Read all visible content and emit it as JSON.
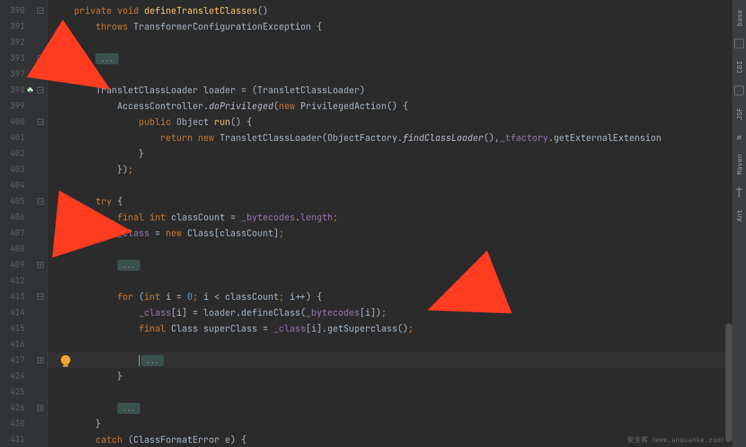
{
  "gutter": {
    "lines": [
      "390",
      "391",
      "392",
      "393",
      "397",
      "398",
      "399",
      "400",
      "401",
      "402",
      "403",
      "404",
      "405",
      "406",
      "407",
      "408",
      "409",
      "412",
      "413",
      "414",
      "415",
      "416",
      "417",
      "424",
      "425",
      "426",
      "430",
      "431"
    ]
  },
  "fold_chip": "...",
  "code": {
    "l390": {
      "indent": "    ",
      "tokens": [
        {
          "c": "k",
          "t": "private"
        },
        {
          "c": "t",
          "t": " "
        },
        {
          "c": "k",
          "t": "void"
        },
        {
          "c": "t",
          "t": " "
        },
        {
          "c": "m",
          "t": "defineTransletClasses"
        },
        {
          "c": "t",
          "t": "()"
        }
      ]
    },
    "l391": {
      "indent": "        ",
      "tokens": [
        {
          "c": "k",
          "t": "throws"
        },
        {
          "c": "t",
          "t": " TransformerConfigurationException {"
        }
      ]
    },
    "l392": {
      "indent": "",
      "tokens": []
    },
    "l393": {
      "indent": "        ",
      "chip": true
    },
    "l397": {
      "indent": "",
      "tokens": []
    },
    "l398": {
      "indent": "        ",
      "tokens": [
        {
          "c": "t",
          "t": "TransletClassLoader loader = (TransletClassLoader)"
        }
      ]
    },
    "l399": {
      "indent": "            ",
      "tokens": [
        {
          "c": "t",
          "t": "AccessController."
        },
        {
          "c": "it",
          "t": "doPrivileged"
        },
        {
          "c": "t",
          "t": "("
        },
        {
          "c": "k",
          "t": "new"
        },
        {
          "c": "t",
          "t": " PrivilegedAction() {"
        }
      ]
    },
    "l400": {
      "indent": "                ",
      "tokens": [
        {
          "c": "k",
          "t": "public"
        },
        {
          "c": "t",
          "t": " Object "
        },
        {
          "c": "m",
          "t": "run"
        },
        {
          "c": "t",
          "t": "() {"
        }
      ]
    },
    "l401": {
      "indent": "                    ",
      "tokens": [
        {
          "c": "k",
          "t": "return"
        },
        {
          "c": "t",
          "t": " "
        },
        {
          "c": "k",
          "t": "new"
        },
        {
          "c": "t",
          "t": " TransletClassLoader(ObjectFactory."
        },
        {
          "c": "it",
          "t": "findClassLoader"
        },
        {
          "c": "t",
          "t": "(),"
        },
        {
          "c": "f",
          "t": "_tfactory"
        },
        {
          "c": "t",
          "t": ".getExternalExtension"
        }
      ]
    },
    "l402": {
      "indent": "                ",
      "tokens": [
        {
          "c": "t",
          "t": "}"
        }
      ]
    },
    "l403": {
      "indent": "            ",
      "tokens": [
        {
          "c": "t",
          "t": "})"
        },
        {
          "c": "k",
          "t": ";"
        }
      ]
    },
    "l404": {
      "indent": "",
      "tokens": []
    },
    "l405": {
      "indent": "        ",
      "tokens": [
        {
          "c": "k",
          "t": "try"
        },
        {
          "c": "t",
          "t": " {"
        }
      ]
    },
    "l406": {
      "indent": "            ",
      "tokens": [
        {
          "c": "k",
          "t": "final"
        },
        {
          "c": "t",
          "t": " "
        },
        {
          "c": "k",
          "t": "int"
        },
        {
          "c": "t",
          "t": " classCount = "
        },
        {
          "c": "f",
          "t": "_bytecodes"
        },
        {
          "c": "t",
          "t": "."
        },
        {
          "c": "f",
          "t": "length"
        },
        {
          "c": "k",
          "t": ";"
        }
      ]
    },
    "l407": {
      "indent": "            ",
      "tokens": [
        {
          "c": "f",
          "t": "_class"
        },
        {
          "c": "t",
          "t": " = "
        },
        {
          "c": "k",
          "t": "new"
        },
        {
          "c": "t",
          "t": " Class[classCount]"
        },
        {
          "c": "k",
          "t": ";"
        }
      ]
    },
    "l408": {
      "indent": "",
      "tokens": []
    },
    "l409": {
      "indent": "            ",
      "chip": true
    },
    "l412": {
      "indent": "",
      "tokens": []
    },
    "l413": {
      "indent": "            ",
      "tokens": [
        {
          "c": "k",
          "t": "for"
        },
        {
          "c": "t",
          "t": " ("
        },
        {
          "c": "k",
          "t": "int"
        },
        {
          "c": "t",
          "t": " i = "
        },
        {
          "c": "n",
          "t": "0"
        },
        {
          "c": "k",
          "t": ";"
        },
        {
          "c": "t",
          "t": " i < classCount"
        },
        {
          "c": "k",
          "t": ";"
        },
        {
          "c": "t",
          "t": " i++) {"
        }
      ]
    },
    "l414": {
      "indent": "                ",
      "tokens": [
        {
          "c": "f",
          "t": "_class"
        },
        {
          "c": "t",
          "t": "[i] = loader.defineClass("
        },
        {
          "c": "f",
          "t": "_bytecodes"
        },
        {
          "c": "t",
          "t": "[i])"
        },
        {
          "c": "k",
          "t": ";"
        }
      ]
    },
    "l415": {
      "indent": "                ",
      "tokens": [
        {
          "c": "k",
          "t": "final"
        },
        {
          "c": "t",
          "t": " Class superClass = "
        },
        {
          "c": "f",
          "t": "_class"
        },
        {
          "c": "t",
          "t": "[i].getSuperclass()"
        },
        {
          "c": "k",
          "t": ";"
        }
      ]
    },
    "l416": {
      "indent": "",
      "tokens": []
    },
    "l417": {
      "indent": "                ",
      "caret": true,
      "chip": true
    },
    "l424": {
      "indent": "            ",
      "tokens": [
        {
          "c": "t",
          "t": "}"
        }
      ]
    },
    "l425": {
      "indent": "",
      "tokens": []
    },
    "l426": {
      "indent": "            ",
      "chip": true
    },
    "l430": {
      "indent": "        ",
      "tokens": [
        {
          "c": "t",
          "t": "}"
        }
      ]
    },
    "l431": {
      "indent": "        ",
      "tokens": [
        {
          "c": "k",
          "t": "catch"
        },
        {
          "c": "t",
          "t": " (ClassFormatError e) {"
        }
      ]
    }
  },
  "sidebar": {
    "items": [
      {
        "label": "base",
        "icon": "database-icon"
      },
      {
        "label": "CDI",
        "icon": "cdi-icon"
      },
      {
        "label": "JSF",
        "icon": "jsf-icon"
      },
      {
        "label": "Maven",
        "icon": "maven-icon"
      },
      {
        "label": "Ant",
        "icon": "ant-icon"
      }
    ]
  },
  "watermark": "安全客（www.anquanke.com）",
  "annotation_arrows": [
    {
      "name": "arrow-1",
      "points_at": "l398"
    },
    {
      "name": "arrow-2",
      "points_at": "l407"
    },
    {
      "name": "arrow-3",
      "points_at": "l414"
    }
  ],
  "colors": {
    "bg": "#2b2b2b",
    "gutter": "#313335",
    "keyword": "#cc7832",
    "method": "#ffc66d",
    "field": "#9876aa",
    "number": "#6897bb",
    "arrow": "#ff3b20"
  }
}
